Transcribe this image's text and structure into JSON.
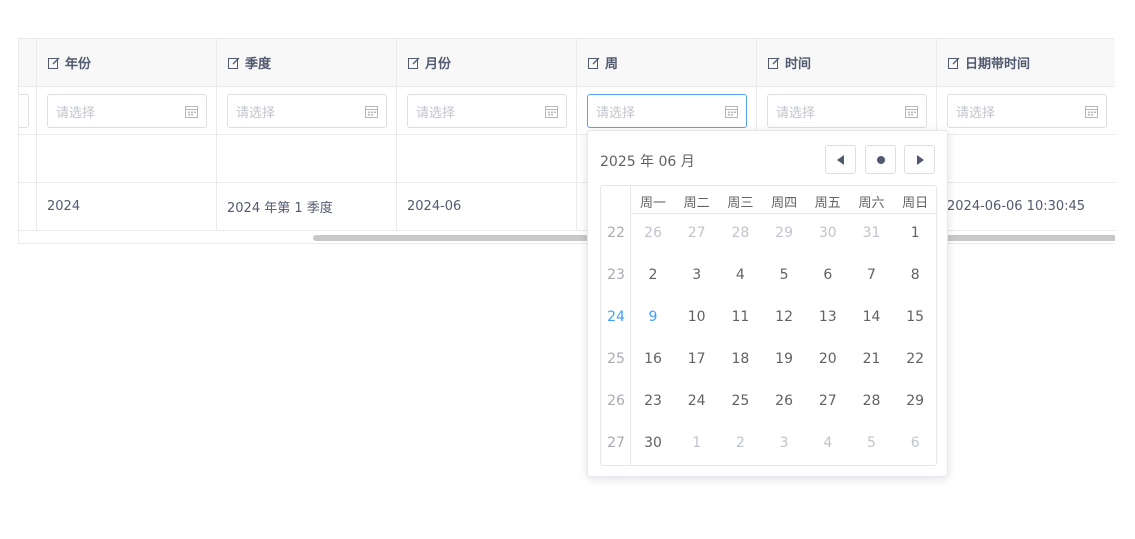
{
  "columns": [
    {
      "label": "年份",
      "placeholder": "请选择",
      "value": "2024"
    },
    {
      "label": "季度",
      "placeholder": "请选择",
      "value": "2024 年第 1 季度"
    },
    {
      "label": "月份",
      "placeholder": "请选择",
      "value": "2024-06"
    },
    {
      "label": "周",
      "placeholder": "请选择",
      "value": ""
    },
    {
      "label": "时间",
      "placeholder": "请选择",
      "value": ""
    },
    {
      "label": "日期带时间",
      "placeholder": "请选择",
      "value": "2024-06-06 10:30:45"
    }
  ],
  "datepicker": {
    "title": "2025 年  06 月",
    "weekdays": [
      "周一",
      "周二",
      "周三",
      "周四",
      "周五",
      "周六",
      "周日"
    ],
    "weeks": [
      {
        "week": "22",
        "days": [
          {
            "d": "26",
            "muted": true
          },
          {
            "d": "27",
            "muted": true
          },
          {
            "d": "28",
            "muted": true
          },
          {
            "d": "29",
            "muted": true
          },
          {
            "d": "30",
            "muted": true
          },
          {
            "d": "31",
            "muted": true
          },
          {
            "d": "1"
          }
        ]
      },
      {
        "week": "23",
        "days": [
          {
            "d": "2"
          },
          {
            "d": "3"
          },
          {
            "d": "4"
          },
          {
            "d": "5"
          },
          {
            "d": "6"
          },
          {
            "d": "7"
          },
          {
            "d": "8"
          }
        ]
      },
      {
        "week": "24",
        "current": true,
        "days": [
          {
            "d": "9",
            "today": true
          },
          {
            "d": "10"
          },
          {
            "d": "11"
          },
          {
            "d": "12"
          },
          {
            "d": "13"
          },
          {
            "d": "14"
          },
          {
            "d": "15"
          }
        ]
      },
      {
        "week": "25",
        "days": [
          {
            "d": "16"
          },
          {
            "d": "17"
          },
          {
            "d": "18"
          },
          {
            "d": "19"
          },
          {
            "d": "20"
          },
          {
            "d": "21"
          },
          {
            "d": "22"
          }
        ]
      },
      {
        "week": "26",
        "days": [
          {
            "d": "23"
          },
          {
            "d": "24"
          },
          {
            "d": "25"
          },
          {
            "d": "26"
          },
          {
            "d": "27"
          },
          {
            "d": "28"
          },
          {
            "d": "29"
          }
        ]
      },
      {
        "week": "27",
        "days": [
          {
            "d": "30"
          },
          {
            "d": "1",
            "muted": true
          },
          {
            "d": "2",
            "muted": true
          },
          {
            "d": "3",
            "muted": true
          },
          {
            "d": "4",
            "muted": true
          },
          {
            "d": "5",
            "muted": true
          },
          {
            "d": "6",
            "muted": true
          }
        ]
      }
    ]
  },
  "icons": {
    "edit": "edit-icon",
    "calendar": "calendar-icon",
    "prev": "caret-left-icon",
    "today": "dot-icon",
    "next": "caret-right-icon"
  },
  "colors": {
    "accent": "#409eff",
    "border": "#e8eaec",
    "header_bg": "#f8f8f9"
  }
}
